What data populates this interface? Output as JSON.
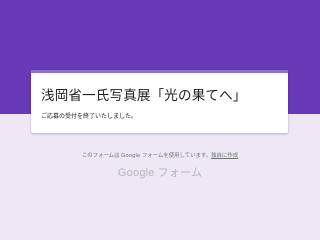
{
  "form": {
    "title": "浅岡省一氏写真展「光の果てへ」",
    "closed_message": "ご応募の受付を終了いたしました。"
  },
  "footer": {
    "notice": "このフォームは Google フォームを使用しています。",
    "create_link": "独自に作成"
  },
  "brand": {
    "google": "Google",
    "forms": "フォーム"
  },
  "colors": {
    "banner": "#673ab7",
    "background": "#ede7f6",
    "accent": "#8e6fd0"
  }
}
